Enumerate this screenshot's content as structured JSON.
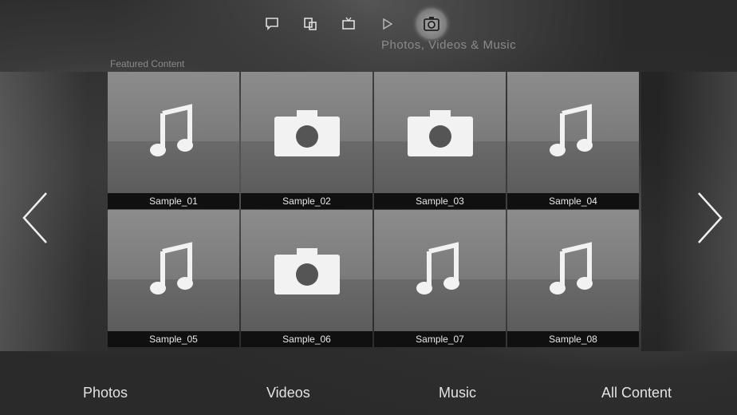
{
  "header": {
    "icons": [
      {
        "name": "chat-icon"
      },
      {
        "name": "multiscreen-icon"
      },
      {
        "name": "tv-icon"
      },
      {
        "name": "play-icon"
      },
      {
        "name": "camera-icon",
        "active": true
      }
    ],
    "title": "Photos, Videos & Music"
  },
  "section_label": "Featured Content",
  "tiles": [
    {
      "label": "Sample_01",
      "type": "music"
    },
    {
      "label": "Sample_02",
      "type": "photo"
    },
    {
      "label": "Sample_03",
      "type": "photo"
    },
    {
      "label": "Sample_04",
      "type": "music"
    },
    {
      "label": "Sample_05",
      "type": "music"
    },
    {
      "label": "Sample_06",
      "type": "photo"
    },
    {
      "label": "Sample_07",
      "type": "music"
    },
    {
      "label": "Sample_08",
      "type": "music"
    }
  ],
  "bottom_nav": {
    "photos": "Photos",
    "videos": "Videos",
    "music": "Music",
    "all_content": "All Content"
  },
  "colors": {
    "tile_label_bg": "#101010",
    "text": "#e2e2e2"
  }
}
